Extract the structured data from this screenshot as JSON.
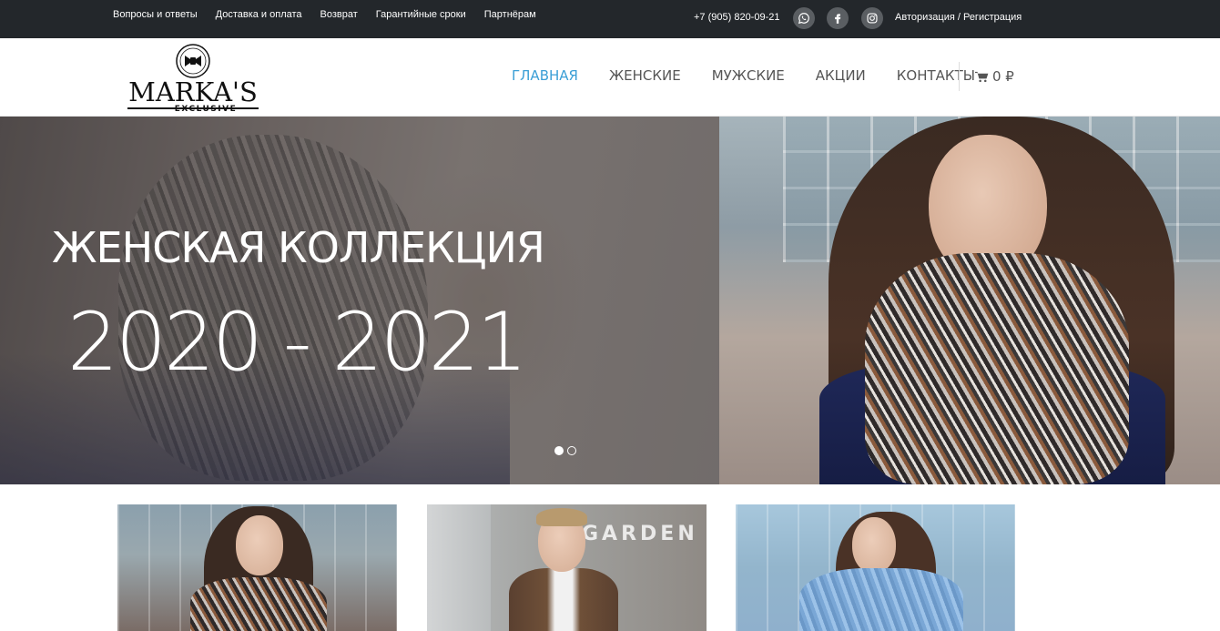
{
  "topbar": {
    "links": [
      "Вопросы и ответы",
      "Доставка и оплата",
      "Возврат",
      "Гарантийные сроки",
      "Партнёрам"
    ],
    "phone": "+7 (905) 820-09-21",
    "social": [
      "whatsapp-icon",
      "facebook-icon",
      "instagram-icon"
    ],
    "auth": "Авторизация / Регистрация"
  },
  "header": {
    "logo_text": "MARKA'S",
    "logo_sub": "EXCLUSIVE",
    "nav": [
      "ГЛАВНАЯ",
      "ЖЕНСКИЕ",
      "МУЖСКИЕ",
      "АКЦИИ",
      "КОНТАКТЫ"
    ],
    "active_nav": "ГЛАВНАЯ",
    "cart_amount": "0 ₽"
  },
  "hero": {
    "title": "ЖЕНСКАЯ КОЛЛЕКЦИЯ",
    "years": "2020 - 2021",
    "slides_total": 2,
    "active_slide": 1
  },
  "cards": {
    "card2_sign": "GARDEN"
  },
  "colors": {
    "topbar_bg": "#23272b",
    "accent": "#3b9fd6",
    "nav_text": "#555555"
  }
}
